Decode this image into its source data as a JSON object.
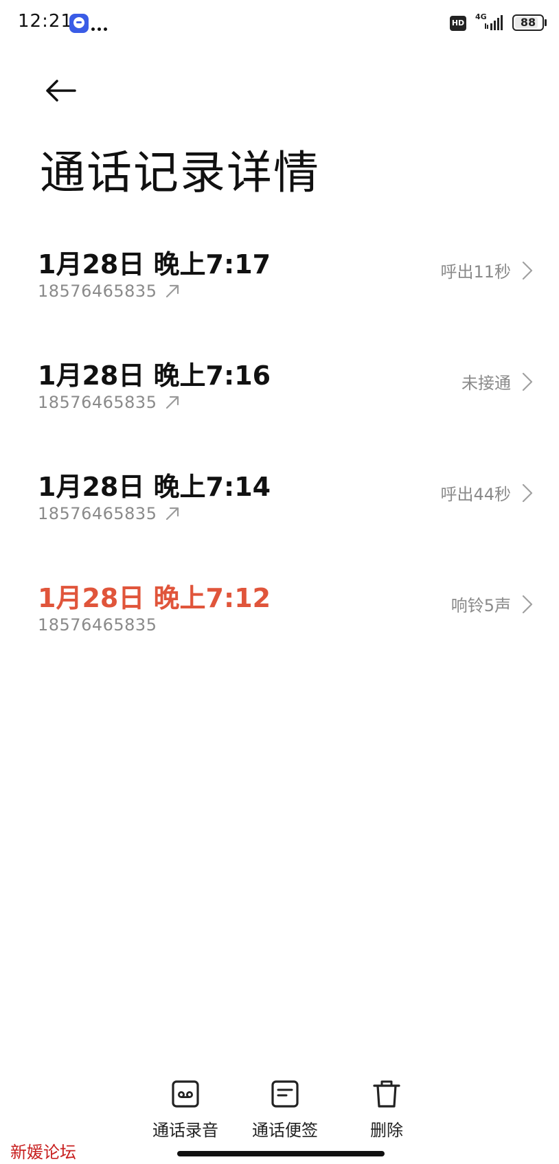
{
  "status_bar": {
    "time": "12:21",
    "network_type": "4G",
    "hd_label": "HD",
    "battery": "88",
    "battery_level": 0.88,
    "notification_icon": "app-chat-icon",
    "icons": [
      "signal-icon",
      "battery-icon"
    ]
  },
  "header": {
    "back_icon": "arrow-left-icon",
    "title": "通话记录详情"
  },
  "calls": [
    {
      "datetime": "1月28日 晚上7:17",
      "number": "18576465835",
      "direction": "outgoing",
      "status": "呼出11秒",
      "missed": false
    },
    {
      "datetime": "1月28日 晚上7:16",
      "number": "18576465835",
      "direction": "outgoing",
      "status": "未接通",
      "missed": false
    },
    {
      "datetime": "1月28日 晚上7:14",
      "number": "18576465835",
      "direction": "outgoing",
      "status": "呼出44秒",
      "missed": false
    },
    {
      "datetime": "1月28日 晚上7:12",
      "number": "18576465835",
      "direction": "incoming",
      "status": "响铃5声",
      "missed": true
    }
  ],
  "colors": {
    "missed": "#e0553b",
    "secondary_text": "#8a8a8a",
    "watermark": "#c82020"
  },
  "bottom_actions": {
    "recording_label": "通话录音",
    "note_label": "通话便签",
    "delete_label": "删除"
  },
  "watermark": "新媛论坛"
}
